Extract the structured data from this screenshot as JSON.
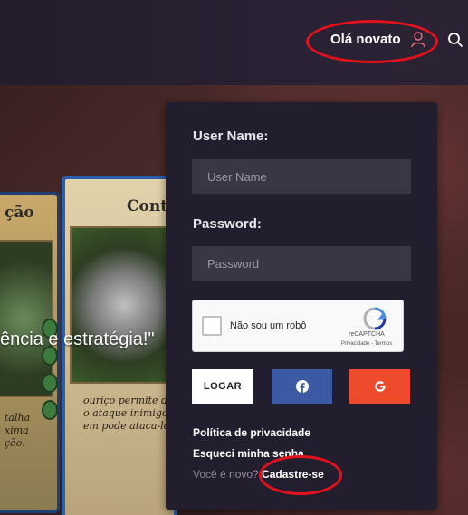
{
  "header": {
    "greeting": "Olá novato",
    "user_icon": "user-icon",
    "search_icon": "search-icon"
  },
  "hero": {
    "card_left_title": "ção",
    "card_right_title": "Conti",
    "card_left_text": "talha\nxima\nção.",
    "card_right_text": "ouriço permite defen\no ataque inimigo, mas\nem pode ataca-lo",
    "gems": [
      "0",
      "0",
      "0",
      "0"
    ],
    "tagline": "ência e estratégia!\""
  },
  "login": {
    "username_label": "User Name:",
    "username_placeholder": "User Name",
    "password_label": "Password:",
    "password_placeholder": "Password",
    "recaptcha_label": "Não sou um robô",
    "recaptcha_brand": "reCAPTCHA",
    "recaptcha_links": "Privacidade - Termos",
    "login_button": "LOGAR",
    "facebook_icon": "facebook-icon",
    "google_icon": "google-icon",
    "privacy_link": "Política de privacidade",
    "forgot_link": "Esqueci minha senha",
    "new_user_text": "Você é novo?",
    "signup_link": "Cadastre-se"
  },
  "colors": {
    "background": "#231e2d",
    "facebook": "#3b5aa3",
    "google": "#ee4a2c",
    "annotation": "#e2111c"
  }
}
